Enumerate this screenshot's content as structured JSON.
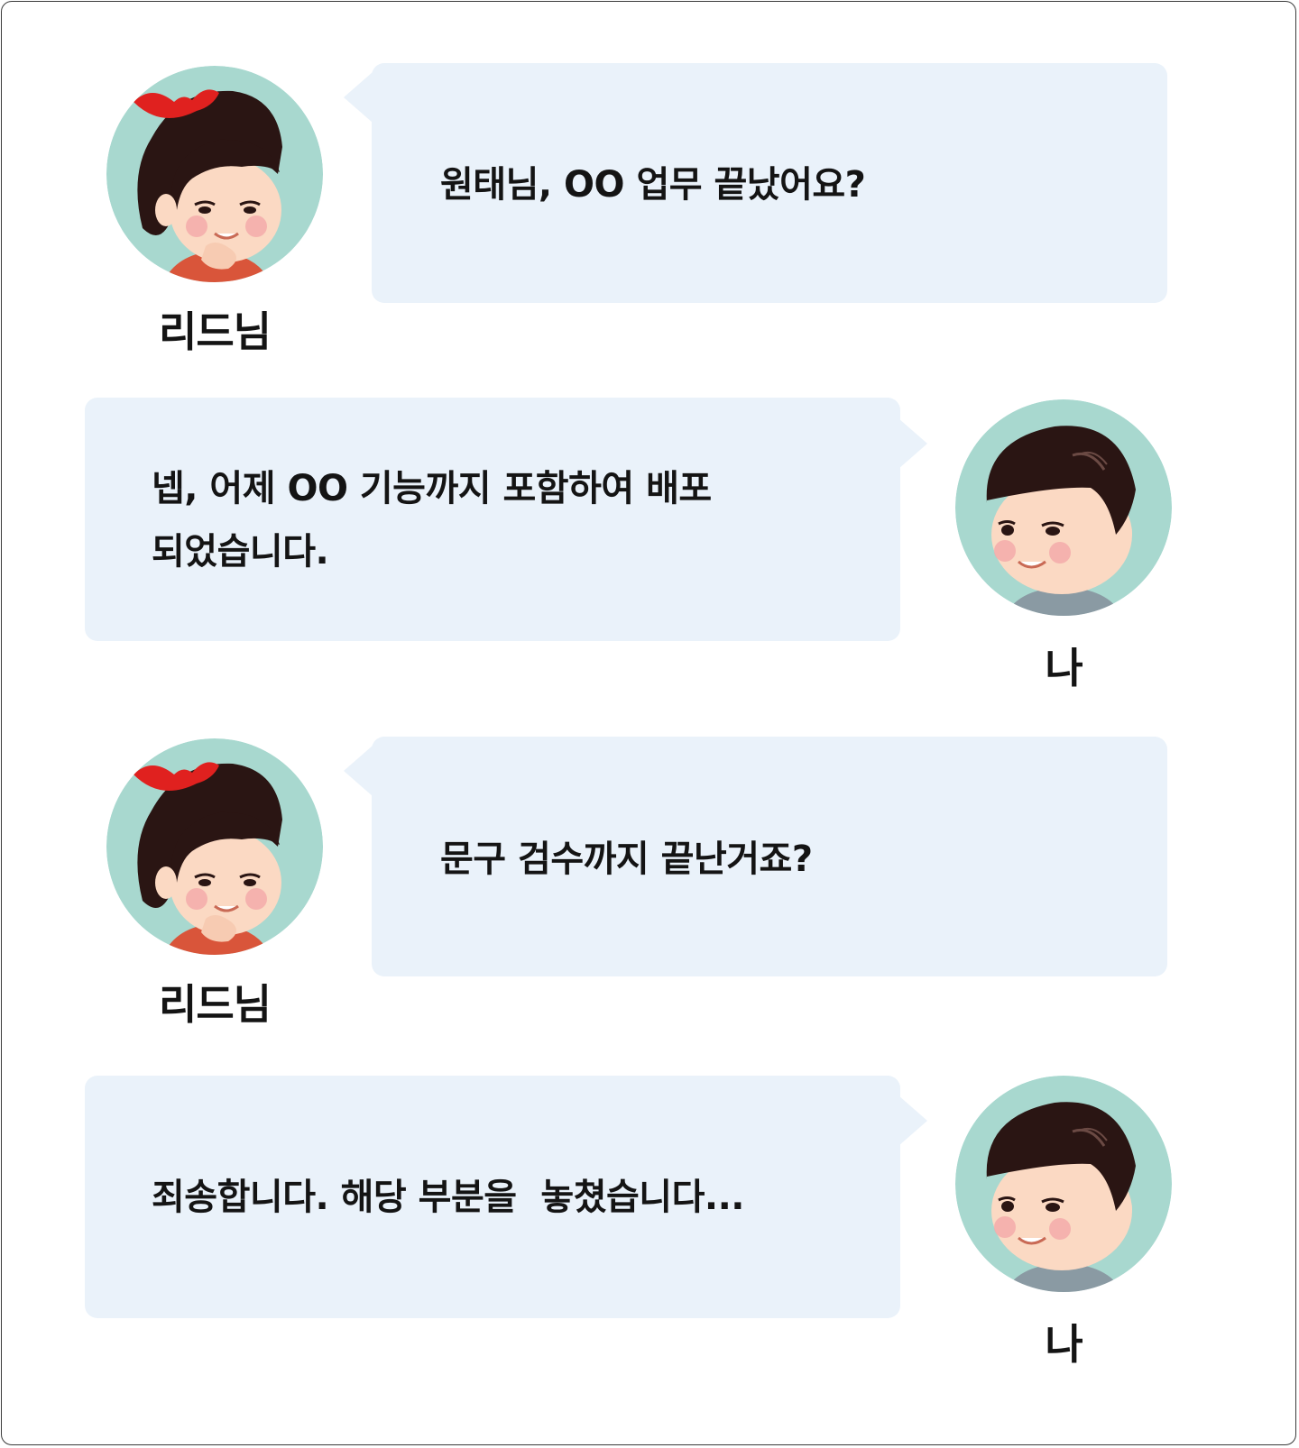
{
  "messages": [
    {
      "speaker": "리드님",
      "avatar": "girl-avatar-icon",
      "text": "원태님, OO 업무 끝났어요?"
    },
    {
      "speaker": "나",
      "avatar": "boy-avatar-icon",
      "text": "넵, 어제 OO 기능까지 포함하여 배포\n되었습니다."
    },
    {
      "speaker": "리드님",
      "avatar": "girl-avatar-icon",
      "text": "문구 검수까지 끝난거죠?"
    },
    {
      "speaker": "나",
      "avatar": "boy-avatar-icon",
      "text": "죄송합니다. 해당 부분을  놓쳤습니다..."
    }
  ],
  "colors": {
    "bubble": "#eaf2fa",
    "avatar_bg": "#a8d8cf",
    "hair": "#2a1513",
    "ribbon": "#e0211f",
    "skin": "#fbd9c3",
    "text": "#141414"
  }
}
